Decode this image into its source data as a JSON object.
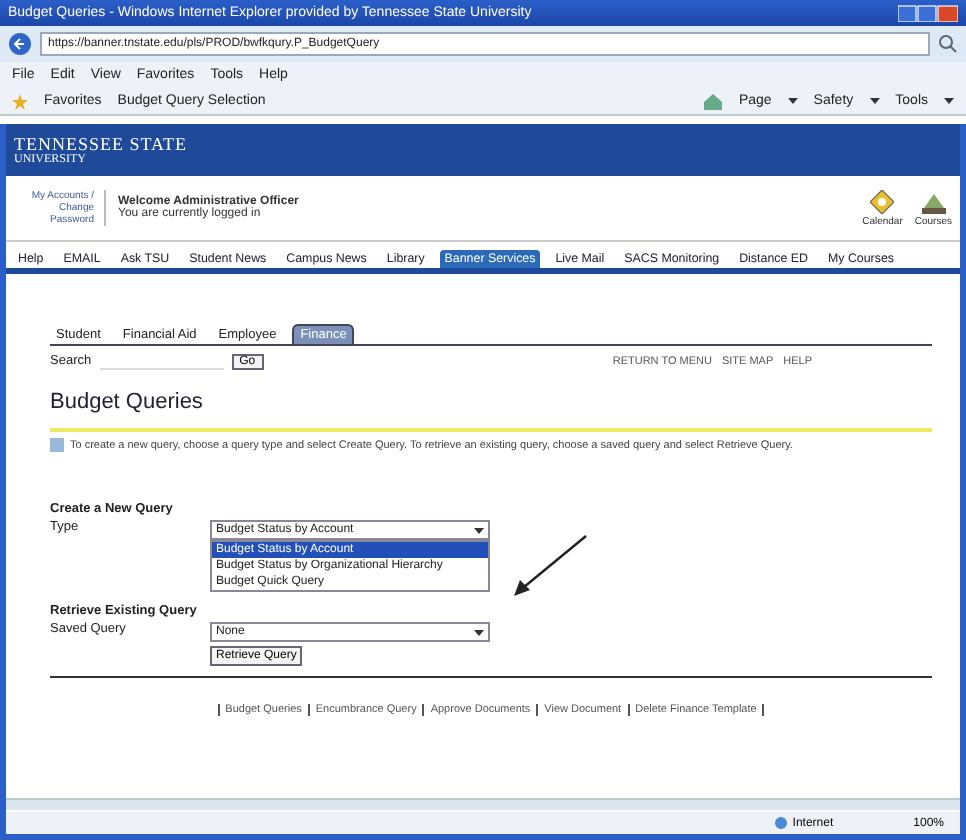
{
  "window": {
    "title": "Budget Queries - Windows Internet Explorer provided by Tennessee State University"
  },
  "address_bar": {
    "url": "https://banner.tnstate.edu/pls/PROD/bwfkqury.P_BudgetQuery"
  },
  "menu": [
    "File",
    "Edit",
    "View",
    "Favorites",
    "Tools",
    "Help"
  ],
  "favorites_bar": [
    "Favorites",
    "Budget Query Selection"
  ],
  "command_bar": [
    "Page",
    "Safety",
    "Tools"
  ],
  "banner": {
    "line1": "TENNESSEE STATE",
    "line2": "UNIVERSITY"
  },
  "user_panel": {
    "link": "My Accounts / Change Password",
    "welcome": "Welcome Administrative Officer",
    "status": "You are currently logged in",
    "icons": [
      "Calendar",
      "Courses"
    ]
  },
  "nav": [
    {
      "label": "Help",
      "selected": false
    },
    {
      "label": "EMAIL",
      "selected": false
    },
    {
      "label": "Ask TSU",
      "selected": false
    },
    {
      "label": "Student News",
      "selected": false
    },
    {
      "label": "Campus News",
      "selected": false
    },
    {
      "label": "Library",
      "selected": false
    },
    {
      "label": "Banner Services",
      "selected": true
    },
    {
      "label": "Live Mail",
      "selected": false
    },
    {
      "label": "SACS Monitoring",
      "selected": false
    },
    {
      "label": "Distance ED",
      "selected": false
    },
    {
      "label": "My Courses",
      "selected": false
    }
  ],
  "tabs": [
    {
      "label": "Student",
      "selected": false
    },
    {
      "label": "Financial Aid",
      "selected": false
    },
    {
      "label": "Employee",
      "selected": false
    },
    {
      "label": "Finance",
      "selected": true
    }
  ],
  "search": {
    "label": "Search",
    "button": "Go"
  },
  "top_links": [
    "RETURN TO MENU",
    "SITE MAP",
    "HELP"
  ],
  "page_title": "Budget Queries",
  "info": "To create a new query, choose a query type and select Create Query. To retrieve an existing query, choose a saved query and select Retrieve Query.",
  "create": {
    "heading": "Create a New Query",
    "label": "Type",
    "value": "Budget Status by Account",
    "expanded": true,
    "options": [
      {
        "label": "Budget Status by Account",
        "selected": true
      },
      {
        "label": "Budget Status by Organizational Hierarchy",
        "selected": false
      },
      {
        "label": "Budget Quick Query",
        "selected": false
      }
    ]
  },
  "retrieve": {
    "heading": "Retrieve Existing Query",
    "label": "Saved Query",
    "value": "None",
    "button": "Retrieve Query"
  },
  "footer_links": [
    "Budget Queries",
    "Encumbrance Query",
    "Approve Documents",
    "View Document",
    "Delete Finance Template"
  ],
  "status_bar": {
    "zone": "Internet",
    "zoom": "100%"
  }
}
